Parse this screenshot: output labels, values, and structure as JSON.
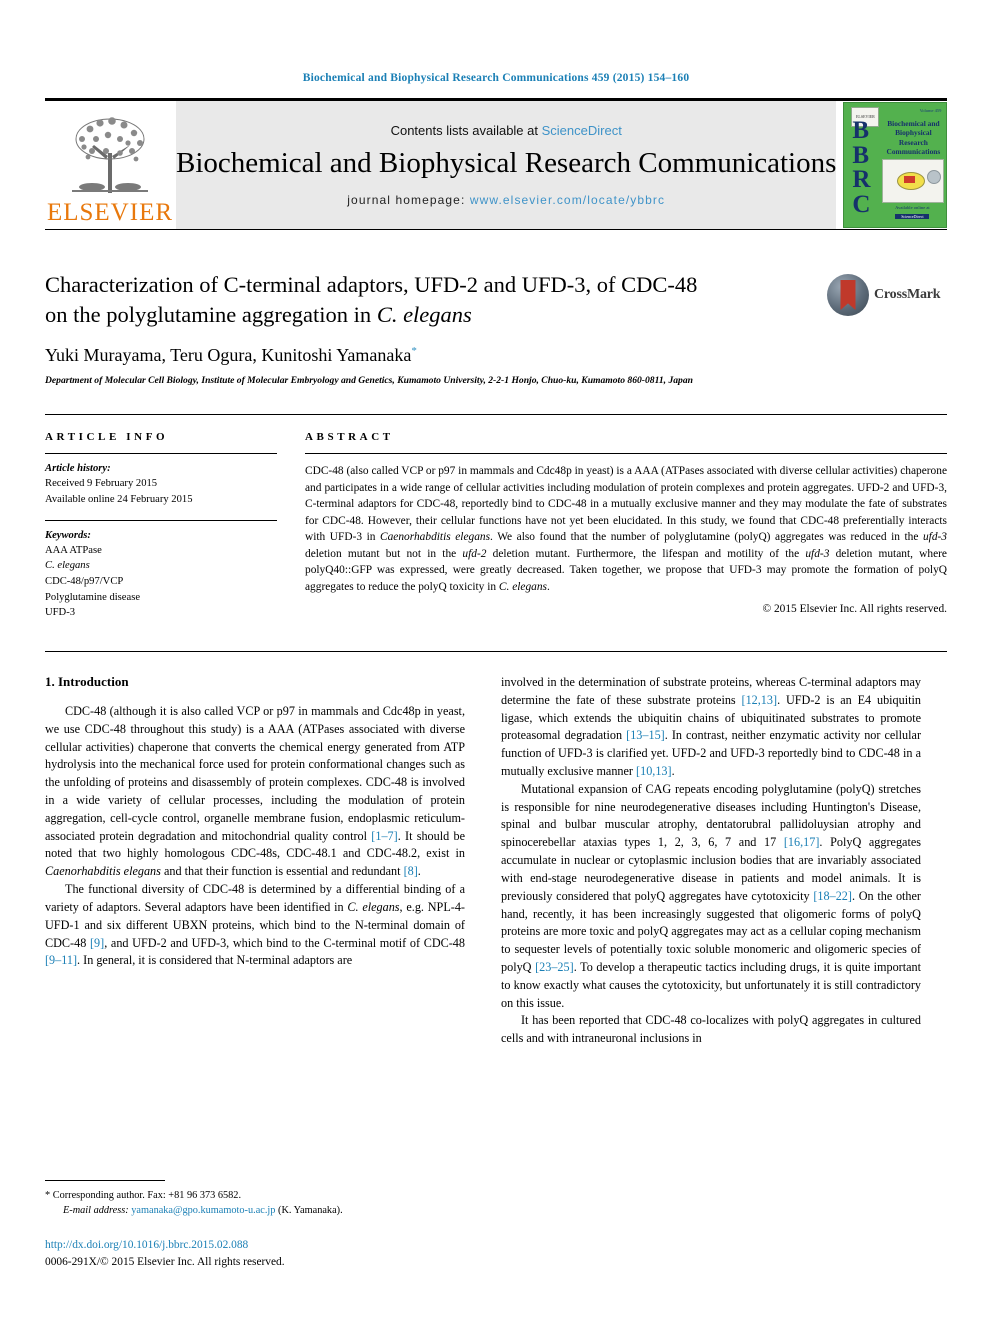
{
  "running_head": "Biochemical and Biophysical Research Communications 459 (2015) 154–160",
  "masthead": {
    "publisher_name": "ELSEVIER",
    "contents_prefix": "Contents lists available at ",
    "contents_link": "ScienceDirect",
    "journal_name": "Biochemical and Biophysical Research Communications",
    "homepage_prefix": "journal homepage: ",
    "homepage_url": "www.elsevier.com/locate/ybbrc",
    "cover": {
      "acronym": "BBRC",
      "title": "Biochemical and Biophysical Research Communications",
      "publisher_mark": "ELSEVIER",
      "corner_note": "Volume 459",
      "footer_text": "Available online at",
      "footer_badge": "ScienceDirect"
    },
    "link_color": "#3f93c8",
    "brand_color": "#E8780C"
  },
  "article": {
    "title_line1": "Characterization of C-terminal adaptors, UFD-2 and UFD-3, of CDC-48",
    "title_line2_pre": "on the polyglutamine aggregation in ",
    "title_line2_italic": "C. elegans",
    "crossmark_label": "CrossMark",
    "authors": "Yuki Murayama, Teru Ogura, Kunitoshi Yamanaka",
    "corresponding_marker": "*",
    "affiliation": "Department of Molecular Cell Biology, Institute of Molecular Embryology and Genetics, Kumamoto University, 2-2-1 Honjo, Chuo-ku, Kumamoto 860-0811, Japan"
  },
  "article_info": {
    "heading": "ARTICLE INFO",
    "history_label": "Article history:",
    "history": [
      "Received 9 February 2015",
      "Available online 24 February 2015"
    ],
    "keywords_label": "Keywords:",
    "keywords": [
      "AAA ATPase",
      "C. elegans",
      "CDC-48/p97/VCP",
      "Polyglutamine disease",
      "UFD-3"
    ]
  },
  "abstract": {
    "heading": "ABSTRACT",
    "paragraph_1": "CDC-48 (also called VCP or p97 in mammals and Cdc48p in yeast) is a AAA (ATPases associated with diverse cellular activities) chaperone and participates in a wide range of cellular activities including modulation of protein complexes and protein aggregates. UFD-2 and UFD-3, C-terminal adaptors for CDC-48, reportedly bind to CDC-48 in a mutually exclusive manner and they may modulate the fate of substrates for CDC-48. However, their cellular functions have not yet been elucidated. In this study, we found that CDC-48 preferentially interacts with UFD-3 in ",
    "italic_1": "Caenorhabditis elegans",
    "paragraph_2": ". We also found that the number of polyglutamine (polyQ) aggregates was reduced in the ",
    "italic_2": "ufd-3",
    "paragraph_3": " deletion mutant but not in the ",
    "italic_3": "ufd-2",
    "paragraph_4": " deletion mutant. Furthermore, the lifespan and motility of the ",
    "italic_4": "ufd-3",
    "paragraph_5": " deletion mutant, where polyQ40::GFP was expressed, were greatly decreased. Taken together, we propose that UFD-3 may promote the formation of polyQ aggregates to reduce the polyQ toxicity in ",
    "italic_5": "C. elegans",
    "paragraph_6": ".",
    "copyright": "© 2015 Elsevier Inc. All rights reserved."
  },
  "introduction": {
    "heading": "1. Introduction",
    "left_column": {
      "p1_a": "CDC-48 (although it is also called VCP or p97 in mammals and Cdc48p in yeast, we use CDC-48 throughout this study) is a AAA (ATPases associated with diverse cellular activities) chaperone that converts the chemical energy generated from ATP hydrolysis into the mechanical force used for protein conformational changes such as the unfolding of proteins and disassembly of protein complexes. CDC-48 is involved in a wide variety of cellular processes, including the modulation of protein aggregation, cell-cycle control, organelle membrane fusion, endoplasmic reticulum-associated protein degradation and mitochondrial quality control ",
      "p1_ref1": "[1–7]",
      "p1_b": ". It should be noted that two highly homologous CDC-48s, CDC-48.1 and CDC-48.2, exist in ",
      "p1_italic": "Caenorhabditis elegans",
      "p1_c": " and that their function is essential and redundant ",
      "p1_ref2": "[8]",
      "p1_d": ".",
      "p2_a": "The functional diversity of CDC-48 is determined by a differential binding of a variety of adaptors. Several adaptors have been identified in ",
      "p2_italic1": "C. elegans",
      "p2_b": ", e.g. NPL-4-UFD-1 and six different UBXN proteins, which bind to the N-terminal domain of CDC-48 ",
      "p2_ref1": "[9]",
      "p2_c": ", and UFD-2 and UFD-3, which bind to the C-terminal motif of CDC-48 ",
      "p2_ref2": "[9–11]",
      "p2_d": ". In general, it is considered that N-terminal adaptors are"
    },
    "right_column": {
      "p1_a": "involved in the determination of substrate proteins, whereas C-terminal adaptors may determine the fate of these substrate proteins ",
      "p1_ref1": "[12,13]",
      "p1_b": ". UFD-2 is an E4 ubiquitin ligase, which extends the ubiquitin chains of ubiquitinated substrates to promote proteasomal degradation ",
      "p1_ref2": "[13–15]",
      "p1_c": ". In contrast, neither enzymatic activity nor cellular function of UFD-3 is clarified yet. UFD-2 and UFD-3 reportedly bind to CDC-48 in a mutually exclusive manner ",
      "p1_ref3": "[10,13]",
      "p1_d": ".",
      "p2_a": "Mutational expansion of CAG repeats encoding polyglutamine (polyQ) stretches is responsible for nine neurodegenerative diseases including Huntington's Disease, spinal and bulbar muscular atrophy, dentatorubral pallidoluysian atrophy and spinocerebellar ataxias types 1, 2, 3, 6, 7 and 17 ",
      "p2_ref1": "[16,17]",
      "p2_b": ". PolyQ aggregates accumulate in nuclear or cytoplasmic inclusion bodies that are invariably associated with end-stage neurodegenerative disease in patients and model animals. It is previously considered that polyQ aggregates have cytotoxicity ",
      "p2_ref2": "[18–22]",
      "p2_c": ". On the other hand, recently, it has been increasingly suggested that oligomeric forms of polyQ proteins are more toxic and polyQ aggregates may act as a cellular coping mechanism to sequester levels of potentially toxic soluble monomeric and oligomeric species of polyQ ",
      "p2_ref3": "[23–25]",
      "p2_d": ". To develop a therapeutic tactics including drugs, it is quite important to know exactly what causes the cytotoxicity, but unfortunately it is still contradictory on this issue.",
      "p3": "It has been reported that CDC-48 co-localizes with polyQ aggregates in cultured cells and with intraneuronal inclusions in"
    }
  },
  "footnote": {
    "marker": "*",
    "corresponding": "Corresponding author. Fax: +81 96 373 6582.",
    "email_label": "E-mail address:",
    "email": "yamanaka@gpo.kumamoto-u.ac.jp",
    "email_suffix": "(K. Yamanaka).",
    "doi": "http://dx.doi.org/10.1016/j.bbrc.2015.02.088",
    "issn": "0006-291X/© 2015 Elsevier Inc. All rights reserved."
  }
}
